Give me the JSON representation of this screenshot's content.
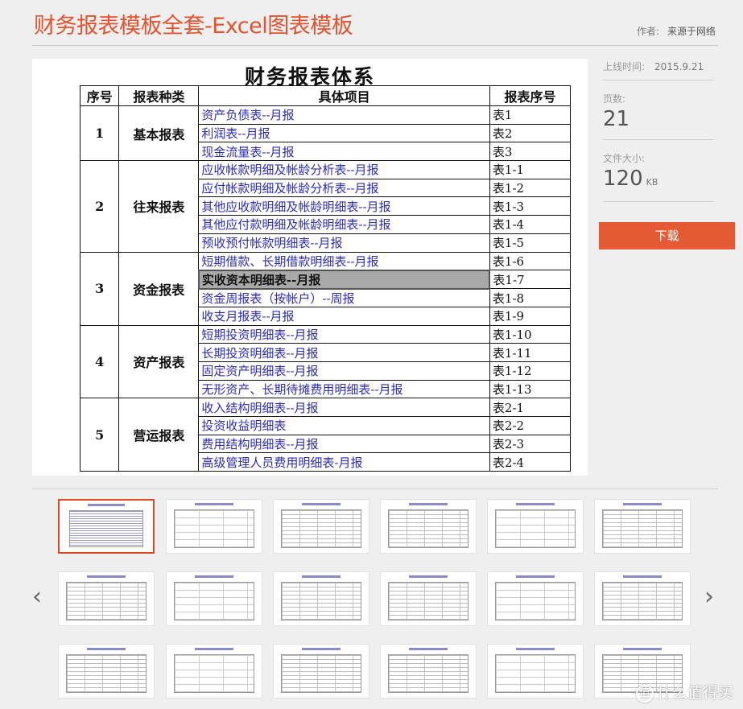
{
  "header": {
    "title": "财务报表模板全套-Excel图表模板",
    "author_label": "作者:",
    "author_value": "来源于网络"
  },
  "info": {
    "online_label": "上线时间:",
    "online_value": "2015.9.21",
    "pages_label": "页数:",
    "pages_value": "21",
    "size_label": "文件大小:",
    "size_value": "120",
    "size_unit": "KB",
    "download_label": "下载"
  },
  "preview": {
    "doc_title": "财务报表体系",
    "headers": [
      "序号",
      "报表种类",
      "具体项目",
      "报表序号"
    ],
    "groups": [
      {
        "seq": "1",
        "category": "基本报表",
        "rows": [
          {
            "item": "资产负债表--月报",
            "code": "表1"
          },
          {
            "item": "利润表--月报",
            "code": "表2"
          },
          {
            "item": "现金流量表--月报",
            "code": "表3"
          }
        ]
      },
      {
        "seq": "2",
        "category": "往来报表",
        "rows": [
          {
            "item": "应收帐款明细及帐龄分析表--月报",
            "code": "表1-1"
          },
          {
            "item": "应付帐款明细及帐龄分析表--月报",
            "code": "表1-2"
          },
          {
            "item": "其他应收款明细及帐龄明细表--月报",
            "code": "表1-3"
          },
          {
            "item": "其他应付款明细及帐龄明细表--月报",
            "code": "表1-4"
          },
          {
            "item": "预收预付帐款明细表--月报",
            "code": "表1-5"
          }
        ]
      },
      {
        "seq": "3",
        "category": "资金报表",
        "rows": [
          {
            "item": "短期借款、长期借款明细表--月报",
            "code": "表1-6"
          },
          {
            "item": "实收资本明细表--月报",
            "code": "表1-7",
            "highlight": true
          },
          {
            "item": "资金周报表（按帐户）--周报",
            "code": "表1-8"
          },
          {
            "item": "收支月报表--月报",
            "code": "表1-9"
          }
        ]
      },
      {
        "seq": "4",
        "category": "资产报表",
        "rows": [
          {
            "item": "短期投资明细表--月报",
            "code": "表1-10"
          },
          {
            "item": "长期投资明细表--月报",
            "code": "表1-11"
          },
          {
            "item": "固定资产明细表--月报",
            "code": "表1-12"
          },
          {
            "item": "无形资产、长期待摊费用明细表--月报",
            "code": "表1-13"
          }
        ]
      },
      {
        "seq": "5",
        "category": "营运报表",
        "rows": [
          {
            "item": "收入结构明细表--月报",
            "code": "表2-1"
          },
          {
            "item": "投资收益明细表",
            "code": "表2-2"
          },
          {
            "item": "费用结构明细表--月报",
            "code": "表2-3"
          },
          {
            "item": "高级管理人员费用明细表-月报",
            "code": "表2-4"
          }
        ]
      }
    ]
  },
  "thumbnails": {
    "count": 18,
    "active_index": 0,
    "prev_icon": "chevron-left-icon",
    "next_icon": "chevron-right-icon"
  },
  "watermark": {
    "badge": "值",
    "text": "什么值得买"
  }
}
